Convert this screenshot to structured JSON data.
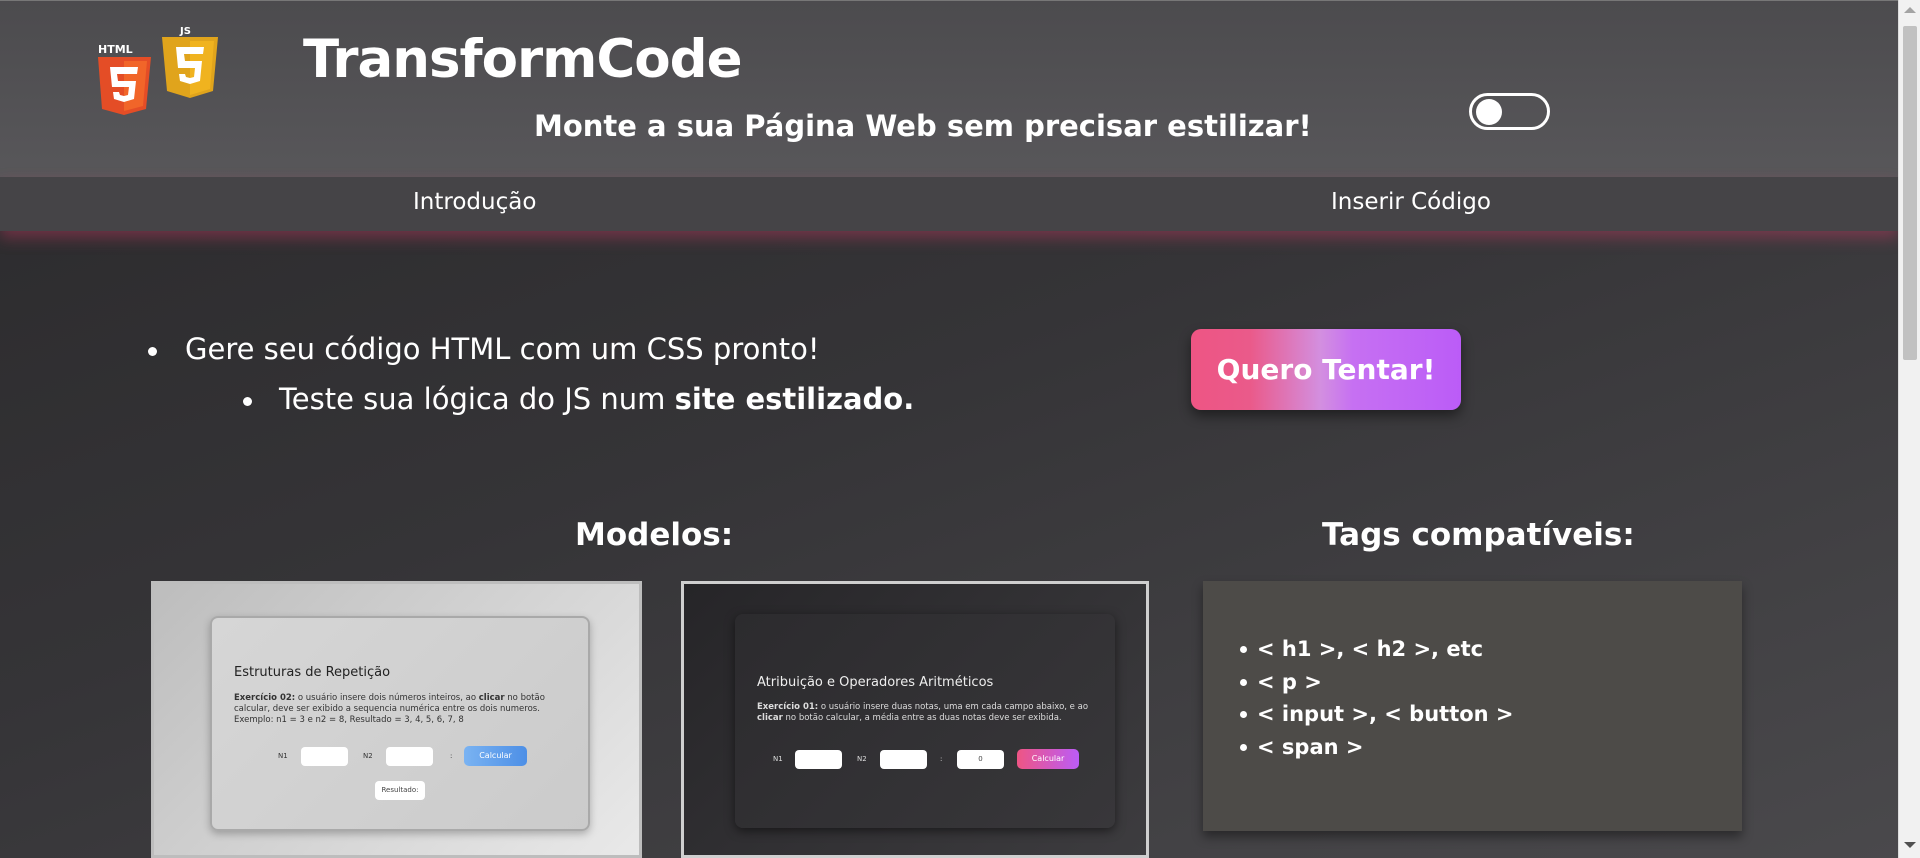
{
  "header": {
    "logo_icons": [
      "html5-icon",
      "js-icon"
    ],
    "logo_html_text": "HTML",
    "logo_js_text": "JS",
    "brand": "TransformCode",
    "tagline": "Monte a sua Página Web sem precisar estilizar!",
    "theme_toggle_on": false
  },
  "nav": {
    "items": [
      {
        "label": "Introdução"
      },
      {
        "label": "Inserir Código"
      }
    ]
  },
  "intro": {
    "bullet1": "Gere seu código HTML com um CSS pronto!",
    "bullet2_prefix": "Teste sua lógica do JS num ",
    "bullet2_bold": "site estilizado.",
    "cta_label": "Quero Tentar!"
  },
  "models": {
    "title": "Modelos:",
    "cards": [
      {
        "title": "Estruturas de Repetição",
        "text_bold1": "Exercício 02:",
        "text_part1": " o usuário insere dois números inteiros, ao ",
        "text_bold2": "clicar",
        "text_part2": " no botão calcular, deve ser exibido a sequencia numérica entre os dois numeros.",
        "example": "Exemplo: n1 = 3 e n2 = 8, Resultado = 3, 4, 5, 6, 7, 8",
        "label_n1": "N1",
        "label_n2": "N2",
        "colon": ":",
        "button": "Calcular",
        "result": "Resultado:"
      },
      {
        "title": "Atribuição e Operadores Aritméticos",
        "text_bold1": "Exercício 01:",
        "text_part1": " o usuário insere duas notas, uma em cada campo abaixo, e ao ",
        "text_bold2": "clicar",
        "text_part2": " no botão calcular, a média entre as duas notas deve ser exibida.",
        "label_n1": "N1",
        "label_n2": "N2",
        "colon": ":",
        "output": "0",
        "button": "Calcular"
      }
    ]
  },
  "tags": {
    "title": "Tags compatíveis:",
    "items": [
      "< h1 >, < h2 >, etc",
      "< p >",
      "< input >, < button >",
      "< span >"
    ]
  },
  "colors": {
    "accent_pink": "#ee5584",
    "accent_purple": "#bb5cf7",
    "header_bg": "#4c4b4e",
    "tags_bg": "#4d4b48"
  }
}
